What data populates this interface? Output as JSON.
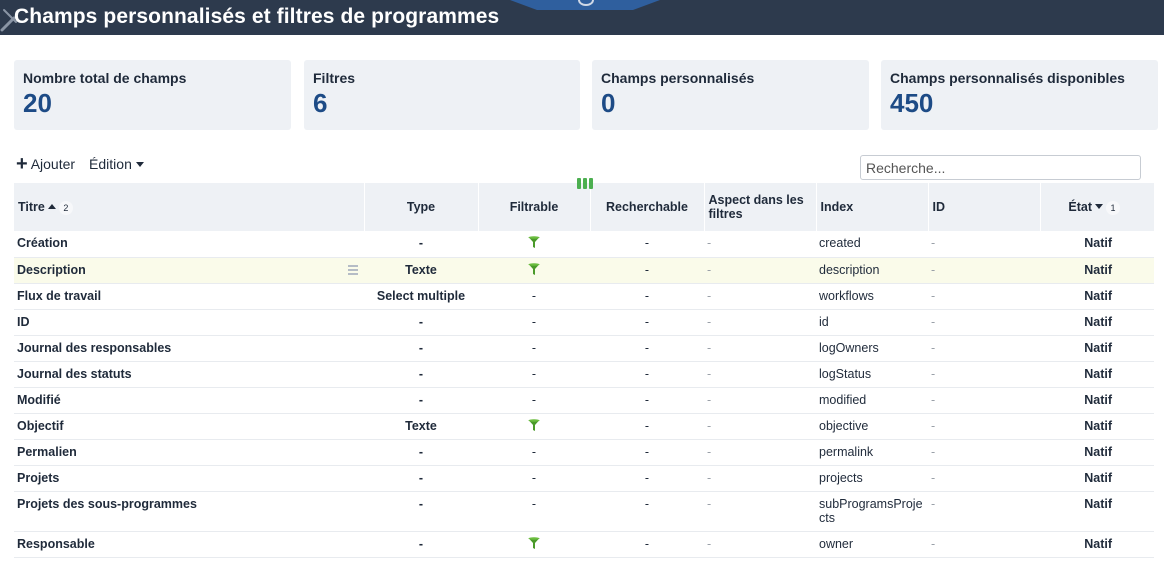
{
  "header": {
    "title": "Champs personnalisés et filtres de programmes"
  },
  "stats": [
    {
      "label": "Nombre total de champs",
      "value": "20"
    },
    {
      "label": "Filtres",
      "value": "6"
    },
    {
      "label": "Champs personnalisés",
      "value": "0"
    },
    {
      "label": "Champs personnalisés disponibles",
      "value": "450"
    }
  ],
  "toolbar": {
    "add_label": "Ajouter",
    "edit_label": "Édition"
  },
  "search": {
    "placeholder": "Recherche..."
  },
  "colors": {
    "header_bg": "#2d3a4d",
    "accent": "#1d4b86",
    "filter_icon": "#4a9a2a"
  },
  "columns": {
    "title": "Titre",
    "title_sort_order": "2",
    "type": "Type",
    "filterable": "Filtrable",
    "searchable": "Recherchable",
    "aspect": "Aspect dans les filtres",
    "index": "Index",
    "id": "ID",
    "state": "État",
    "state_sort_order": "1"
  },
  "rows": [
    {
      "title": "Création",
      "type": "-",
      "filterable": "funnel-icon",
      "searchable": "-",
      "aspect": "-",
      "index": "created",
      "id": "-",
      "state": "Natif"
    },
    {
      "title": "Description",
      "type": "Texte",
      "filterable": "funnel-icon",
      "searchable": "-",
      "aspect": "-",
      "index": "description",
      "id": "-",
      "state": "Natif"
    },
    {
      "title": "Flux de travail",
      "type": "Select multiple",
      "filterable": "-",
      "searchable": "-",
      "aspect": "-",
      "index": "workflows",
      "id": "-",
      "state": "Natif"
    },
    {
      "title": "ID",
      "type": "-",
      "filterable": "-",
      "searchable": "-",
      "aspect": "-",
      "index": "id",
      "id": "-",
      "state": "Natif"
    },
    {
      "title": "Journal des responsables",
      "type": "-",
      "filterable": "-",
      "searchable": "-",
      "aspect": "-",
      "index": "logOwners",
      "id": "-",
      "state": "Natif"
    },
    {
      "title": "Journal des statuts",
      "type": "-",
      "filterable": "-",
      "searchable": "-",
      "aspect": "-",
      "index": "logStatus",
      "id": "-",
      "state": "Natif"
    },
    {
      "title": "Modifié",
      "type": "-",
      "filterable": "-",
      "searchable": "-",
      "aspect": "-",
      "index": "modified",
      "id": "-",
      "state": "Natif"
    },
    {
      "title": "Objectif",
      "type": "Texte",
      "filterable": "funnel-icon",
      "searchable": "-",
      "aspect": "-",
      "index": "objective",
      "id": "-",
      "state": "Natif"
    },
    {
      "title": "Permalien",
      "type": "-",
      "filterable": "-",
      "searchable": "-",
      "aspect": "-",
      "index": "permalink",
      "id": "-",
      "state": "Natif"
    },
    {
      "title": "Projets",
      "type": "-",
      "filterable": "-",
      "searchable": "-",
      "aspect": "-",
      "index": "projects",
      "id": "-",
      "state": "Natif"
    },
    {
      "title": "Projets des sous-programmes",
      "type": "-",
      "filterable": "-",
      "searchable": "-",
      "aspect": "-",
      "index": "subProgramsProjects",
      "id": "-",
      "state": "Natif"
    },
    {
      "title": "Responsable",
      "type": "-",
      "filterable": "funnel-icon",
      "searchable": "-",
      "aspect": "-",
      "index": "owner",
      "id": "-",
      "state": "Natif"
    }
  ]
}
